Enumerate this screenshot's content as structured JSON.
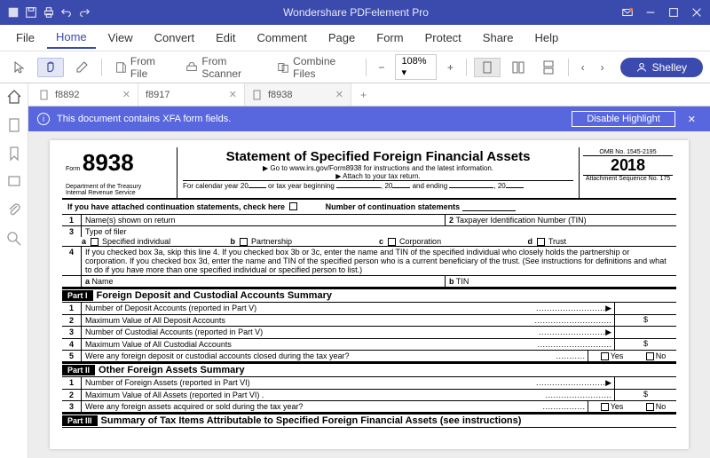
{
  "titlebar": {
    "title": "Wondershare PDFelement Pro"
  },
  "menu": {
    "items": [
      "File",
      "Home",
      "View",
      "Convert",
      "Edit",
      "Comment",
      "Page",
      "Form",
      "Protect",
      "Share",
      "Help"
    ],
    "active": 1
  },
  "toolbar": {
    "from_file": "From File",
    "from_scanner": "From Scanner",
    "combine": "Combine Files",
    "zoom": "108%",
    "user": "Shelley"
  },
  "tabs": {
    "items": [
      {
        "label": "f8892",
        "active": false
      },
      {
        "label": "f8917",
        "active": false
      },
      {
        "label": "f8938",
        "active": true
      }
    ]
  },
  "alert": {
    "message": "This document contains XFA form fields.",
    "button": "Disable Highlight"
  },
  "form": {
    "form_label": "Form",
    "form_number": "8938",
    "dept": "Department of the Treasury",
    "irs": "Internal Revenue Service",
    "title": "Statement of Specified Foreign Financial Assets",
    "goto": "▶ Go to www.irs.gov/Form8938 for instructions and the latest information.",
    "attach": "▶ Attach to your tax return.",
    "cal_line": "For calendar year 20____ or tax year beginning ________, 20____ and ending ________, 20____",
    "omb": "OMB No. 1545-2195",
    "year": "2018",
    "attseq": "Attachment Sequence No. 175",
    "cont_check": "If you have attached continuation statements, check here",
    "cont_num": "Number of continuation statements",
    "l1": {
      "a": "Name(s) shown on return",
      "b": "Taxpayer Identification Number (TIN)"
    },
    "l3": {
      "label": "Type of filer",
      "a": "Specified individual",
      "b": "Partnership",
      "c": "Corporation",
      "d": "Trust"
    },
    "l4": "If you checked box 3a, skip this line 4. If you checked box 3b or 3c, enter the name and TIN of the specified individual who closely holds the partnership or corporation. If you checked box 3d, enter the name and TIN of the specified person who is a current beneficiary of the trust. (See instructions for definitions and what to do if you have more than one specified individual or specified person to list.)",
    "l4a": "Name",
    "l4b": "TIN",
    "part1": {
      "hdr": "Part I",
      "title": "Foreign Deposit and Custodial Accounts Summary",
      "r1": "Number of Deposit Accounts (reported in Part V)",
      "r2": "Maximum Value of All Deposit Accounts",
      "r3": "Number of Custodial Accounts (reported in Part V)",
      "r4": "Maximum Value of All Custodial Accounts",
      "r5": "Were any foreign deposit or custodial accounts closed during the tax year?"
    },
    "part2": {
      "hdr": "Part II",
      "title": "Other Foreign Assets Summary",
      "r1": "Number of Foreign Assets (reported in Part VI)",
      "r2": "Maximum Value of All Assets (reported in Part VI) .",
      "r3": "Were any foreign assets acquired or sold during the tax year?"
    },
    "part3": {
      "hdr": "Part III",
      "title": "Summary of Tax Items Attributable to Specified Foreign Financial Assets (see instructions)"
    },
    "yes": "Yes",
    "no": "No",
    "dollar": "$"
  }
}
